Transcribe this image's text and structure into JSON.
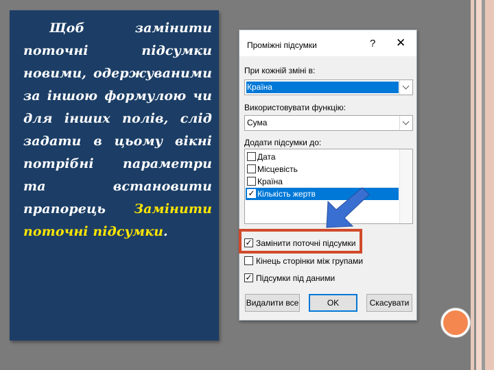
{
  "instruction": {
    "text_before": "Щоб замінити поточні підсумки новими, одержуваними за іншою формулою чи для інших полів, слід задати в цьому вікні потрібні параметри та встановити прапорець ",
    "text_highlight": "Замінити поточні підсумки",
    "text_after": "."
  },
  "dialog": {
    "title": "Проміжні підсумки",
    "help_glyph": "?",
    "close_glyph": "✕",
    "group_by_label": "При кожній зміні в:",
    "group_by_value": "Країна",
    "function_label": "Використовувати функцію:",
    "function_value": "Сума",
    "add_to_label": "Додати підсумки до:",
    "add_to_items": [
      {
        "label": "Дата",
        "checked": false
      },
      {
        "label": "Місцевість",
        "checked": false
      },
      {
        "label": "Країна",
        "checked": false
      },
      {
        "label": "Кількість жертв",
        "checked": true
      }
    ],
    "options": [
      {
        "label": "Замінити поточні підсумки",
        "checked": true
      },
      {
        "label": "Кінець сторінки між групами",
        "checked": false
      },
      {
        "label": "Підсумки під даними",
        "checked": true
      }
    ],
    "buttons": {
      "remove_all": "Видалити все",
      "ok": "OK",
      "cancel": "Скасувати"
    }
  },
  "colors": {
    "panel_background": "#1c3e66",
    "highlight_text": "#ffe600",
    "selection_blue": "#0078d7",
    "callout_border": "#d14a2a",
    "arrow": "#3a6fd2"
  },
  "icons": {
    "pointer_arrow": "arrow-down-left-icon",
    "check": "check-icon"
  }
}
